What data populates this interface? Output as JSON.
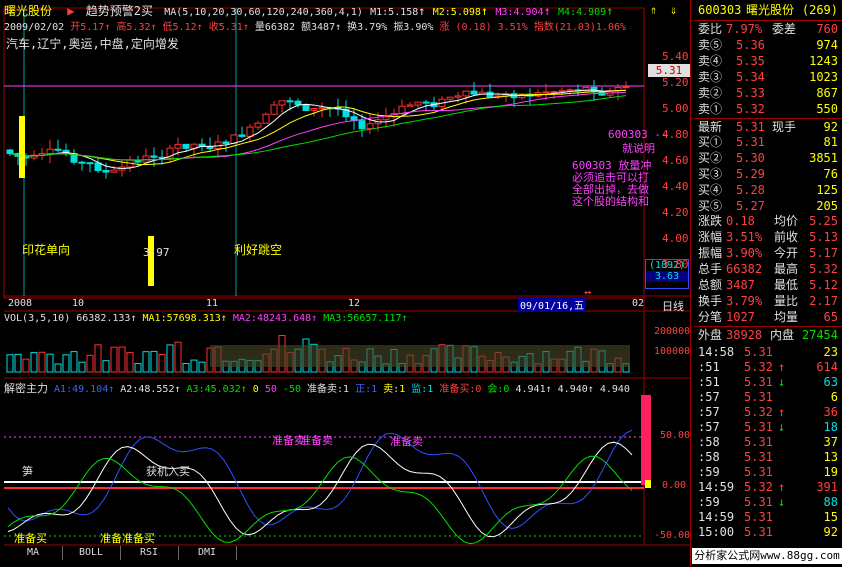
{
  "title_bar": {
    "stock_name": "曙光股份",
    "indicator": "趋势预警2买"
  },
  "ma_line": {
    "label": "MA(5,10,20,30,60,120,240,360,4,1)",
    "m1": "M1:5.158",
    "m2": "M2:5.098",
    "m3": "M3:4.904",
    "m4": "M4:4.909"
  },
  "quote_line": {
    "date": "2009/02/02",
    "open": "开5.17",
    "high": "高5.32",
    "low": "低5.12",
    "close": "收5.31",
    "vol": "量66382",
    "amount": "额3487",
    "turnover": "换3.79%",
    "amplitude": "振3.90%",
    "change": "涨 (0.18) 3.51%",
    "index": "指数(21.03)1.06%"
  },
  "concept": "汽车,辽宁,奥运,中盘,定向增发",
  "price_axis": {
    "ticks": [
      "5.40",
      "5.20",
      "5.00",
      "4.80",
      "4.60",
      "4.40",
      "4.20",
      "4.00",
      "3.80"
    ],
    "current": "5.31",
    "vol_box_top": "(1892)",
    "vol_box_bottom": "3.63"
  },
  "annotations": {
    "yinhua": "印花单向",
    "lihao": "利好跳空",
    "low_price": "3.97",
    "callout1": "600303 --",
    "callout1b": "就说明",
    "callout2": "600303 放量冲",
    "callout2b": "必须追击可以打",
    "callout2c": "全部出掉，去做",
    "callout2d": "这个股的结构和",
    "arrows": "↔"
  },
  "time_axis": {
    "labels": [
      "2008",
      "10",
      "11",
      "12",
      "09/01/16,五",
      "02"
    ],
    "period": "日线"
  },
  "vol_line": {
    "label": "VOL(3,5,10)",
    "value": "66382.133",
    "ma1": "MA1:57698.313",
    "ma2": "MA2:48243.648",
    "ma3": "MA3:56657.117",
    "ticks": [
      "200000",
      "100000"
    ]
  },
  "jiemi_line": {
    "label": "解密主力",
    "a1": "A1:49.104",
    "a2": "A2:48.552",
    "a3": "A3:45.032",
    "z1": "0",
    "z2": "50",
    "z3": "-50",
    "prep_sell": "准备卖:1",
    "zheng": "正:1",
    "sell": "卖:1",
    "jian": "监:1",
    "prep_buy": "准备买:0",
    "hui": "会:0",
    "v1": "4.941",
    "v2": "4.940",
    "v3": "4.940",
    "ticks": [
      "50.00",
      "0.00",
      "-50.00"
    ]
  },
  "signals": {
    "s1": "准备卖",
    "s2": "准备卖",
    "s3": "准备卖",
    "s4": "笋",
    "s5": "准备买",
    "s6": "准备准备买",
    "s7": "获机入买"
  },
  "tabs": [
    "MA",
    "BOLL",
    "RSI",
    "DMI"
  ],
  "side": {
    "code": "600303",
    "name": "曙光股份",
    "code_num": "(269)",
    "webi": {
      "label": "委比",
      "value": "7.97%",
      "label2": "委差",
      "value2": "760"
    },
    "asks": [
      {
        "label": "卖⑤",
        "price": "5.36",
        "vol": "974"
      },
      {
        "label": "卖④",
        "price": "5.35",
        "vol": "1243"
      },
      {
        "label": "卖③",
        "price": "5.34",
        "vol": "1023"
      },
      {
        "label": "卖②",
        "price": "5.33",
        "vol": "867"
      },
      {
        "label": "卖①",
        "price": "5.32",
        "vol": "550"
      }
    ],
    "latest": {
      "label": "最新",
      "price": "5.31",
      "label2": "现手",
      "vol": "92"
    },
    "bids": [
      {
        "label": "买①",
        "price": "5.31",
        "vol": "81"
      },
      {
        "label": "买②",
        "price": "5.30",
        "vol": "3851"
      },
      {
        "label": "买③",
        "price": "5.29",
        "vol": "76"
      },
      {
        "label": "买④",
        "price": "5.28",
        "vol": "125"
      },
      {
        "label": "买⑤",
        "price": "5.27",
        "vol": "205"
      }
    ],
    "stats": [
      {
        "l1": "涨跌",
        "v1": "0.18",
        "l2": "均价",
        "v2": "5.25"
      },
      {
        "l1": "涨幅",
        "v1": "3.51%",
        "l2": "前收",
        "v2": "5.13"
      },
      {
        "l1": "振幅",
        "v1": "3.90%",
        "l2": "今开",
        "v2": "5.17"
      },
      {
        "l1": "总手",
        "v1": "66382",
        "l2": "最高",
        "v2": "5.32"
      },
      {
        "l1": "总额",
        "v1": "3487",
        "l2": "最低",
        "v2": "5.12"
      },
      {
        "l1": "换手",
        "v1": "3.79%",
        "l2": "量比",
        "v2": "2.17"
      },
      {
        "l1": "分笔",
        "v1": "1027",
        "l2": "均量",
        "v2": "65"
      }
    ],
    "waipan": {
      "label": "外盘",
      "value": "38928",
      "label2": "内盘",
      "value2": "27454"
    },
    "ticks": [
      {
        "time": "14:58",
        "price": "5.31",
        "arrow": "",
        "vol": "23"
      },
      {
        "time": ":51",
        "price": "5.32",
        "arrow": "↑",
        "vol": "614"
      },
      {
        "time": ":51",
        "price": "5.31",
        "arrow": "↓",
        "vol": "63"
      },
      {
        "time": ":57",
        "price": "5.31",
        "arrow": "",
        "vol": "6"
      },
      {
        "time": ":57",
        "price": "5.32",
        "arrow": "↑",
        "vol": "36"
      },
      {
        "time": ":57",
        "price": "5.31",
        "arrow": "↓",
        "vol": "18"
      },
      {
        "time": ":58",
        "price": "5.31",
        "arrow": "",
        "vol": "37"
      },
      {
        "time": ":58",
        "price": "5.31",
        "arrow": "",
        "vol": "13"
      },
      {
        "time": ":59",
        "price": "5.31",
        "arrow": "",
        "vol": "19"
      },
      {
        "time": "14:59",
        "price": "5.32",
        "arrow": "↑",
        "vol": "391"
      },
      {
        "time": ":59",
        "price": "5.31",
        "arrow": "↓",
        "vol": "88"
      },
      {
        "time": "14:59",
        "price": "5.31",
        "arrow": "",
        "vol": "15"
      },
      {
        "time": "15:00",
        "price": "5.31",
        "arrow": "",
        "vol": "92"
      }
    ],
    "footer": "分析家公式网www.88gg.com"
  }
}
